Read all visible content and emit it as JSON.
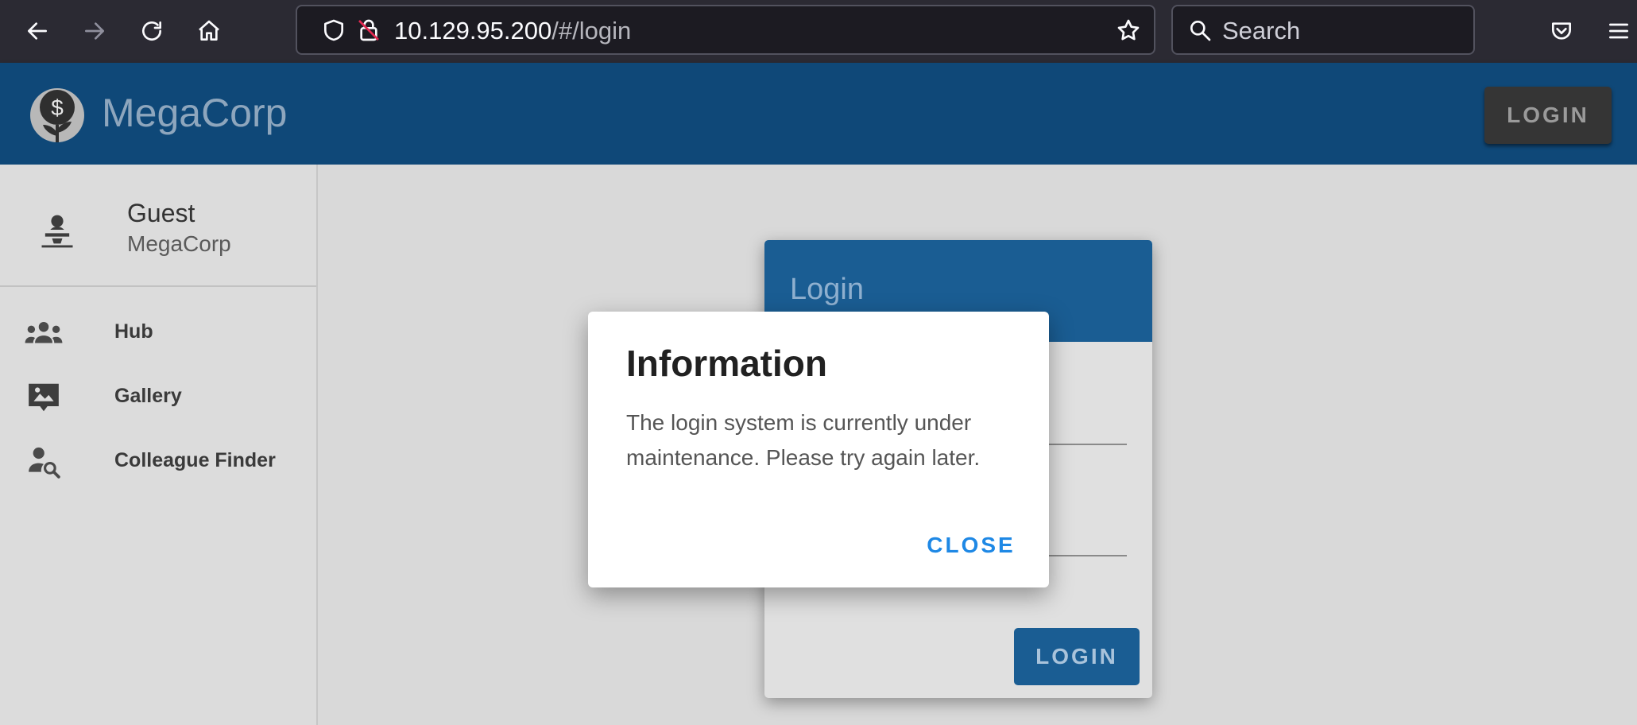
{
  "browser": {
    "url_host": "10.129.95.200",
    "url_path": "/#/login",
    "search_placeholder": "Search",
    "icons": [
      "back-icon",
      "forward-icon",
      "reload-icon",
      "home-icon",
      "shield-icon",
      "insecure-lock-icon",
      "bookmark-star-icon",
      "search-icon",
      "pocket-icon",
      "menu-icon"
    ]
  },
  "appbar": {
    "brand": "MegaCorp",
    "login_label": "LOGIN",
    "color": "#0f4878"
  },
  "sidebar": {
    "user_name": "Guest",
    "user_org": "MegaCorp",
    "items": [
      {
        "label": "Hub",
        "icon": "group-icon"
      },
      {
        "label": "Gallery",
        "icon": "gallery-icon"
      },
      {
        "label": "Colleague Finder",
        "icon": "person-search-icon"
      }
    ]
  },
  "login_card": {
    "title": "Login",
    "button_label": "LOGIN"
  },
  "dialog": {
    "title": "Information",
    "message": "The login system is currently under maintenance. Please try again later.",
    "close_label": "CLOSE",
    "accent": "#1e88e5"
  }
}
